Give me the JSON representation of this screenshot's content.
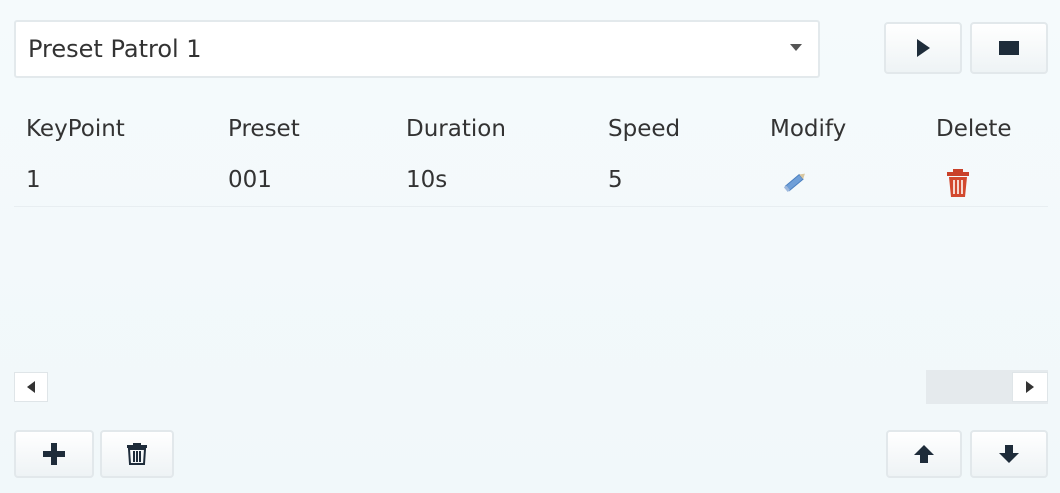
{
  "patrol": {
    "selected": "Preset Patrol 1",
    "play_icon": "play-icon",
    "stop_icon": "stop-icon"
  },
  "table": {
    "headers": [
      "KeyPoint",
      "Preset",
      "Duration",
      "Speed",
      "Modify",
      "Delete"
    ],
    "rows": [
      {
        "keypoint": "1",
        "preset": "001",
        "duration": "10s",
        "speed": "5",
        "modify_icon": "edit-pencil-icon",
        "delete_icon": "trash-icon"
      }
    ]
  },
  "toolbar": {
    "add_icon": "plus-icon",
    "delete_icon": "trash-icon",
    "up_icon": "arrow-up-icon",
    "down_icon": "arrow-down-icon"
  },
  "colors": {
    "background": "#f3f9fb",
    "icon_dark": "#1e2c3a",
    "modify_blue": "#5a8fd0",
    "delete_red": "#c9412a"
  }
}
